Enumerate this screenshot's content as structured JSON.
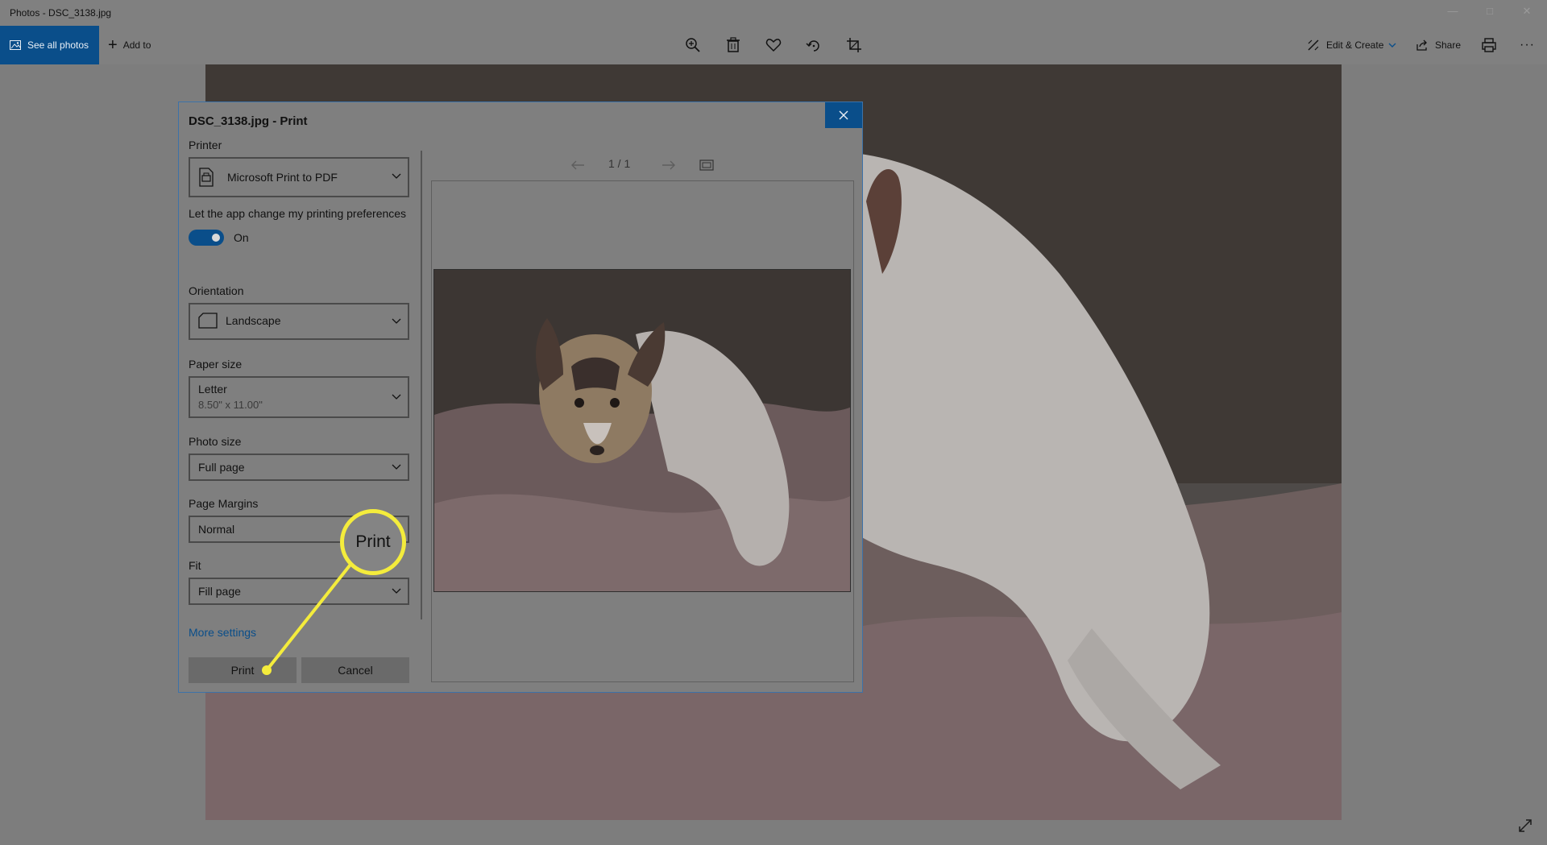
{
  "window": {
    "title": "Photos - DSC_3138.jpg"
  },
  "toolbar": {
    "see_all_photos": "See all photos",
    "add_to": "Add to",
    "icons": [
      "zoom-in-icon",
      "delete-icon",
      "heart-icon",
      "rotate-icon",
      "crop-icon"
    ],
    "edit_create": "Edit & Create",
    "share": "Share",
    "more": "···"
  },
  "dialog": {
    "title": "DSC_3138.jpg - Print",
    "printer_label": "Printer",
    "printer_value": "Microsoft Print to PDF",
    "pref_label": "Let the app change my printing preferences",
    "pref_state": "On",
    "orientation_label": "Orientation",
    "orientation_value": "Landscape",
    "paper_size_label": "Paper size",
    "paper_size_value": "Letter",
    "paper_size_sub": "8.50\" x 11.00\"",
    "photo_size_label": "Photo size",
    "photo_size_value": "Full page",
    "margins_label": "Page Margins",
    "margins_value": "Normal",
    "fit_label": "Fit",
    "fit_value": "Fill page",
    "more_settings": "More settings",
    "print_button": "Print",
    "cancel_button": "Cancel",
    "page_indicator": "1 / 1"
  },
  "callout": {
    "label": "Print",
    "color": "#f4ec3c"
  },
  "colors": {
    "accent": "#0a4e8a",
    "dim_background": "#7d7d7d"
  }
}
